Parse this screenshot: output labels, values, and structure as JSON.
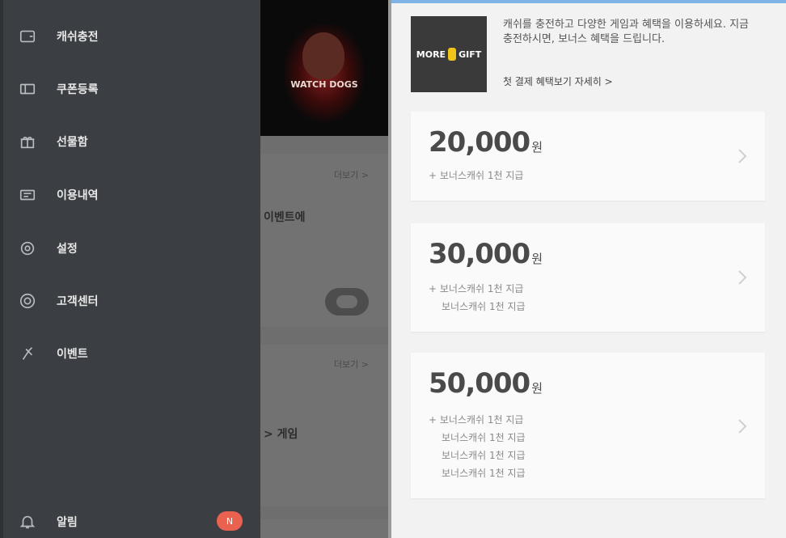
{
  "drawer": {
    "items": [
      {
        "label": "캐쉬충전",
        "icon": "wallet-icon"
      },
      {
        "label": "쿠폰등록",
        "icon": "coupon-icon"
      },
      {
        "label": "선물함",
        "icon": "gift-icon"
      },
      {
        "label": "이용내역",
        "icon": "history-icon"
      },
      {
        "label": "설정",
        "icon": "settings-icon"
      },
      {
        "label": "고객센터",
        "icon": "help-icon"
      },
      {
        "label": "이벤트",
        "icon": "event-icon"
      }
    ],
    "alarm": {
      "label": "알림",
      "badge": "N",
      "icon": "bell-icon"
    }
  },
  "middle": {
    "banner_caption": "WATCH DOGS",
    "sections": [
      {
        "more": "더보기 >",
        "title": "이벤트에"
      },
      {
        "more": "더보기 >",
        "title": "> 게임"
      }
    ]
  },
  "promo": {
    "logo_left": "MORE",
    "logo_right": "GIFT",
    "description": "캐쉬를 충전하고 다양한 게임과 혜택을 이용하세요. 지금 충전하시면, 보너스 혜택을 드립니다.",
    "link": "첫 결제 혜택보기 자세히 >"
  },
  "cards": [
    {
      "amount": "20,000",
      "unit": "원",
      "lines": [
        "+ 보너스캐쉬 1천 지급"
      ]
    },
    {
      "amount": "30,000",
      "unit": "원",
      "lines": [
        "+ 보너스캐쉬 1천 지급",
        "보너스캐쉬 1천 지급"
      ]
    },
    {
      "amount": "50,000",
      "unit": "원",
      "lines": [
        "+ 보너스캐쉬 1천 지급",
        "보너스캐쉬 1천 지급",
        "보너스캐쉬 1천 지급",
        "보너스캐쉬 1천 지급"
      ]
    }
  ],
  "colors": {
    "drawer_bg": "#3b3e42",
    "badge": "#e8624f",
    "accent_top": "#7fb5e6"
  }
}
